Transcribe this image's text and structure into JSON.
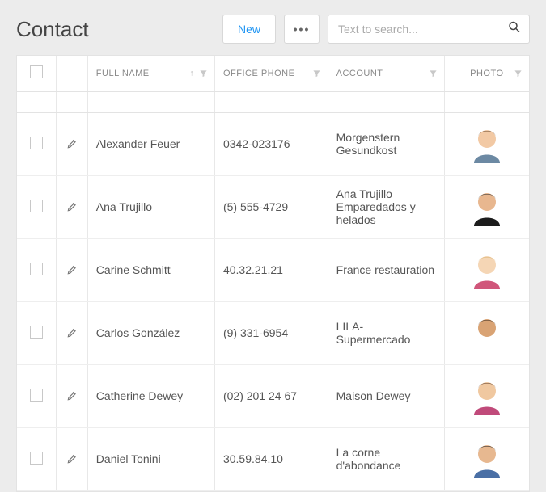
{
  "header": {
    "title": "Contact",
    "new_label": "New",
    "search_placeholder": "Text to search..."
  },
  "columns": {
    "full_name": "FULL NAME",
    "office_phone": "OFFICE PHONE",
    "account": "ACCOUNT",
    "photo": "PHOTO"
  },
  "rows": [
    {
      "full_name": "Alexander Feuer",
      "office_phone": "0342-023176",
      "account": "Morgenstern Gesundkost"
    },
    {
      "full_name": "Ana Trujillo",
      "office_phone": "(5) 555-4729",
      "account": "Ana Trujillo Emparedados y helados"
    },
    {
      "full_name": "Carine Schmitt",
      "office_phone": "40.32.21.21",
      "account": "France restauration"
    },
    {
      "full_name": "Carlos González",
      "office_phone": "(9) 331-6954",
      "account": "LILA-Supermercado"
    },
    {
      "full_name": "Catherine Dewey",
      "office_phone": "(02) 201 24 67",
      "account": "Maison Dewey"
    },
    {
      "full_name": "Daniel Tonini",
      "office_phone": "30.59.84.10",
      "account": "La corne d'abondance"
    }
  ]
}
